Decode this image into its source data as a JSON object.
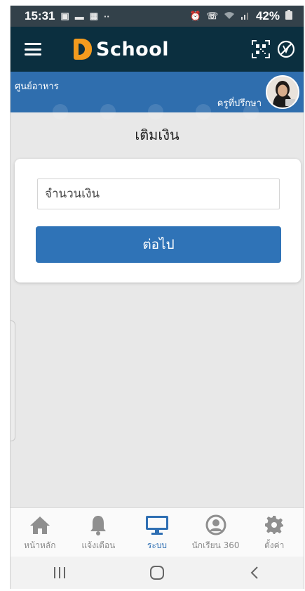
{
  "status_bar": {
    "time": "15:31",
    "battery": "42%",
    "left_icons": [
      "image-icon",
      "message-icon",
      "calendar-icon",
      "more-icon"
    ],
    "right_icons": [
      "alarm-icon",
      "call-icon",
      "wifi-icon",
      "signal-icon",
      "battery-icon"
    ]
  },
  "app_bar": {
    "logo_text": "School",
    "brand_color": "#f39b1e",
    "bg_color": "#0b2f3f"
  },
  "banner": {
    "org_name": "ศูนย์อาหาร",
    "role": "ครูที่ปรึกษา",
    "bg_color": "#2f6eae"
  },
  "page": {
    "title": "เติมเงิน",
    "amount_placeholder": "จำนวนเงิน",
    "next_label": "ต่อไป",
    "accent_color": "#2f73b7"
  },
  "bottom_nav": {
    "items": [
      {
        "label": "หน้าหลัก",
        "icon": "home-icon",
        "active": false
      },
      {
        "label": "แจ้งเตือน",
        "icon": "bell-icon",
        "active": false
      },
      {
        "label": "ระบบ",
        "icon": "monitor-icon",
        "active": true
      },
      {
        "label": "นักเรียน 360",
        "icon": "student-icon",
        "active": false
      },
      {
        "label": "ตั้งค่า",
        "icon": "gear-icon",
        "active": false
      }
    ]
  }
}
